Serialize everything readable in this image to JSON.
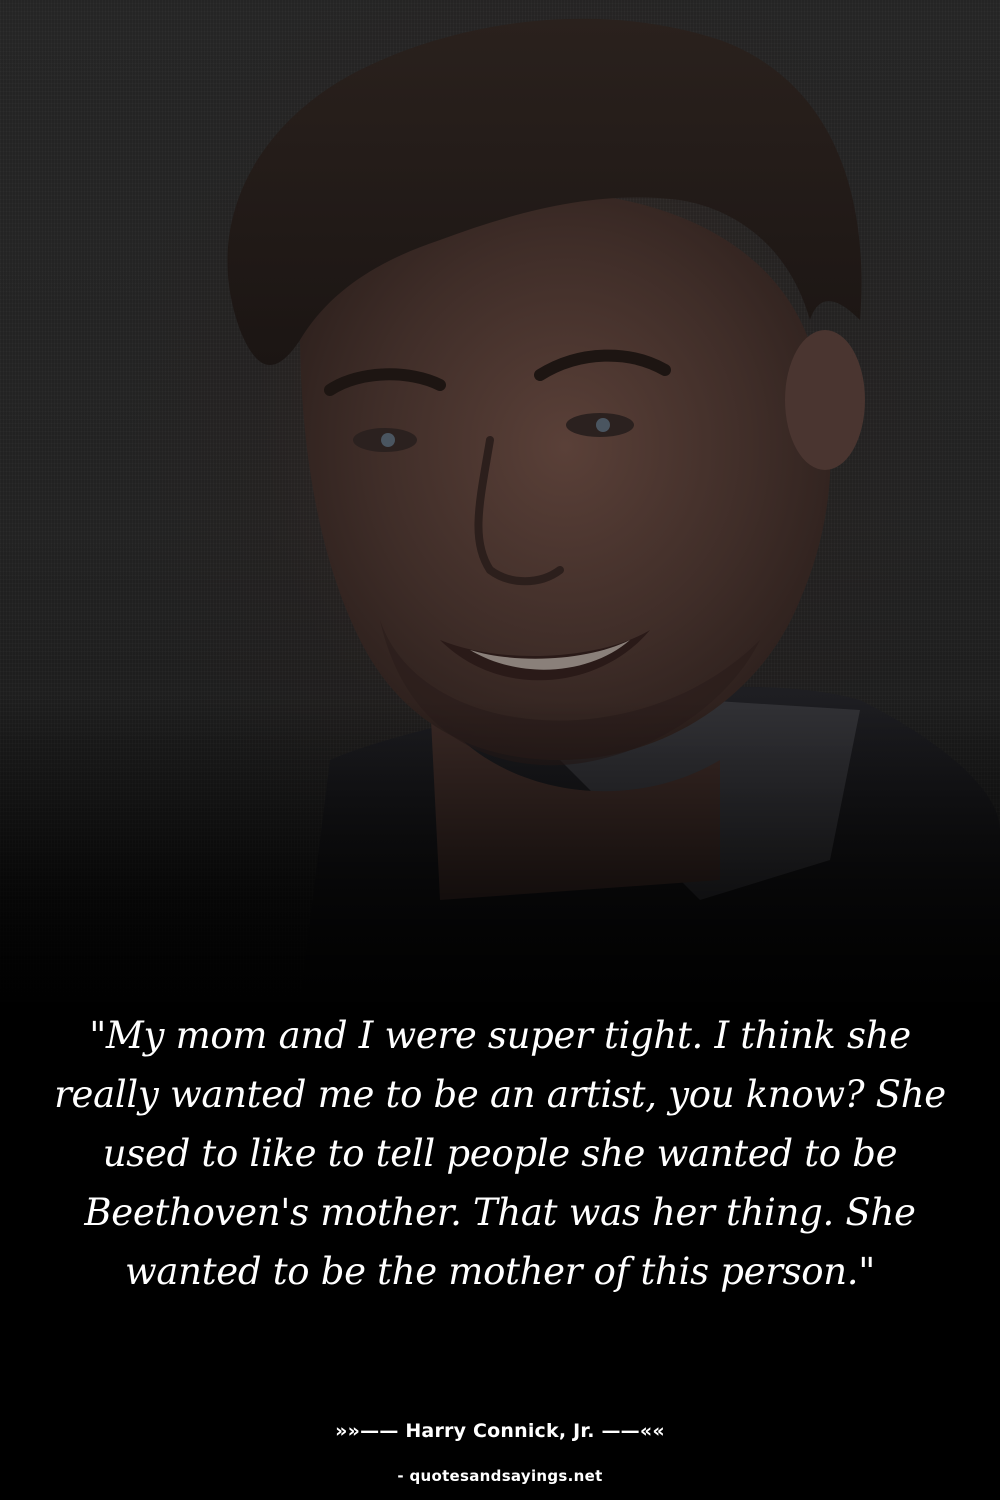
{
  "image": {
    "subject": "portrait-photo"
  },
  "quote": {
    "text": "\"My mom and I were super tight. I think she really wanted me to be an artist, you know? She used to like to tell people she wanted to be Beethoven's mother. That was her thing. She wanted to be the mother of this person.\""
  },
  "author": {
    "line": "»»—— Harry Connick, Jr. ——««"
  },
  "source": {
    "line": "- quotesandsayings.net"
  },
  "colors": {
    "background": "#000000",
    "text": "#ffffff"
  }
}
